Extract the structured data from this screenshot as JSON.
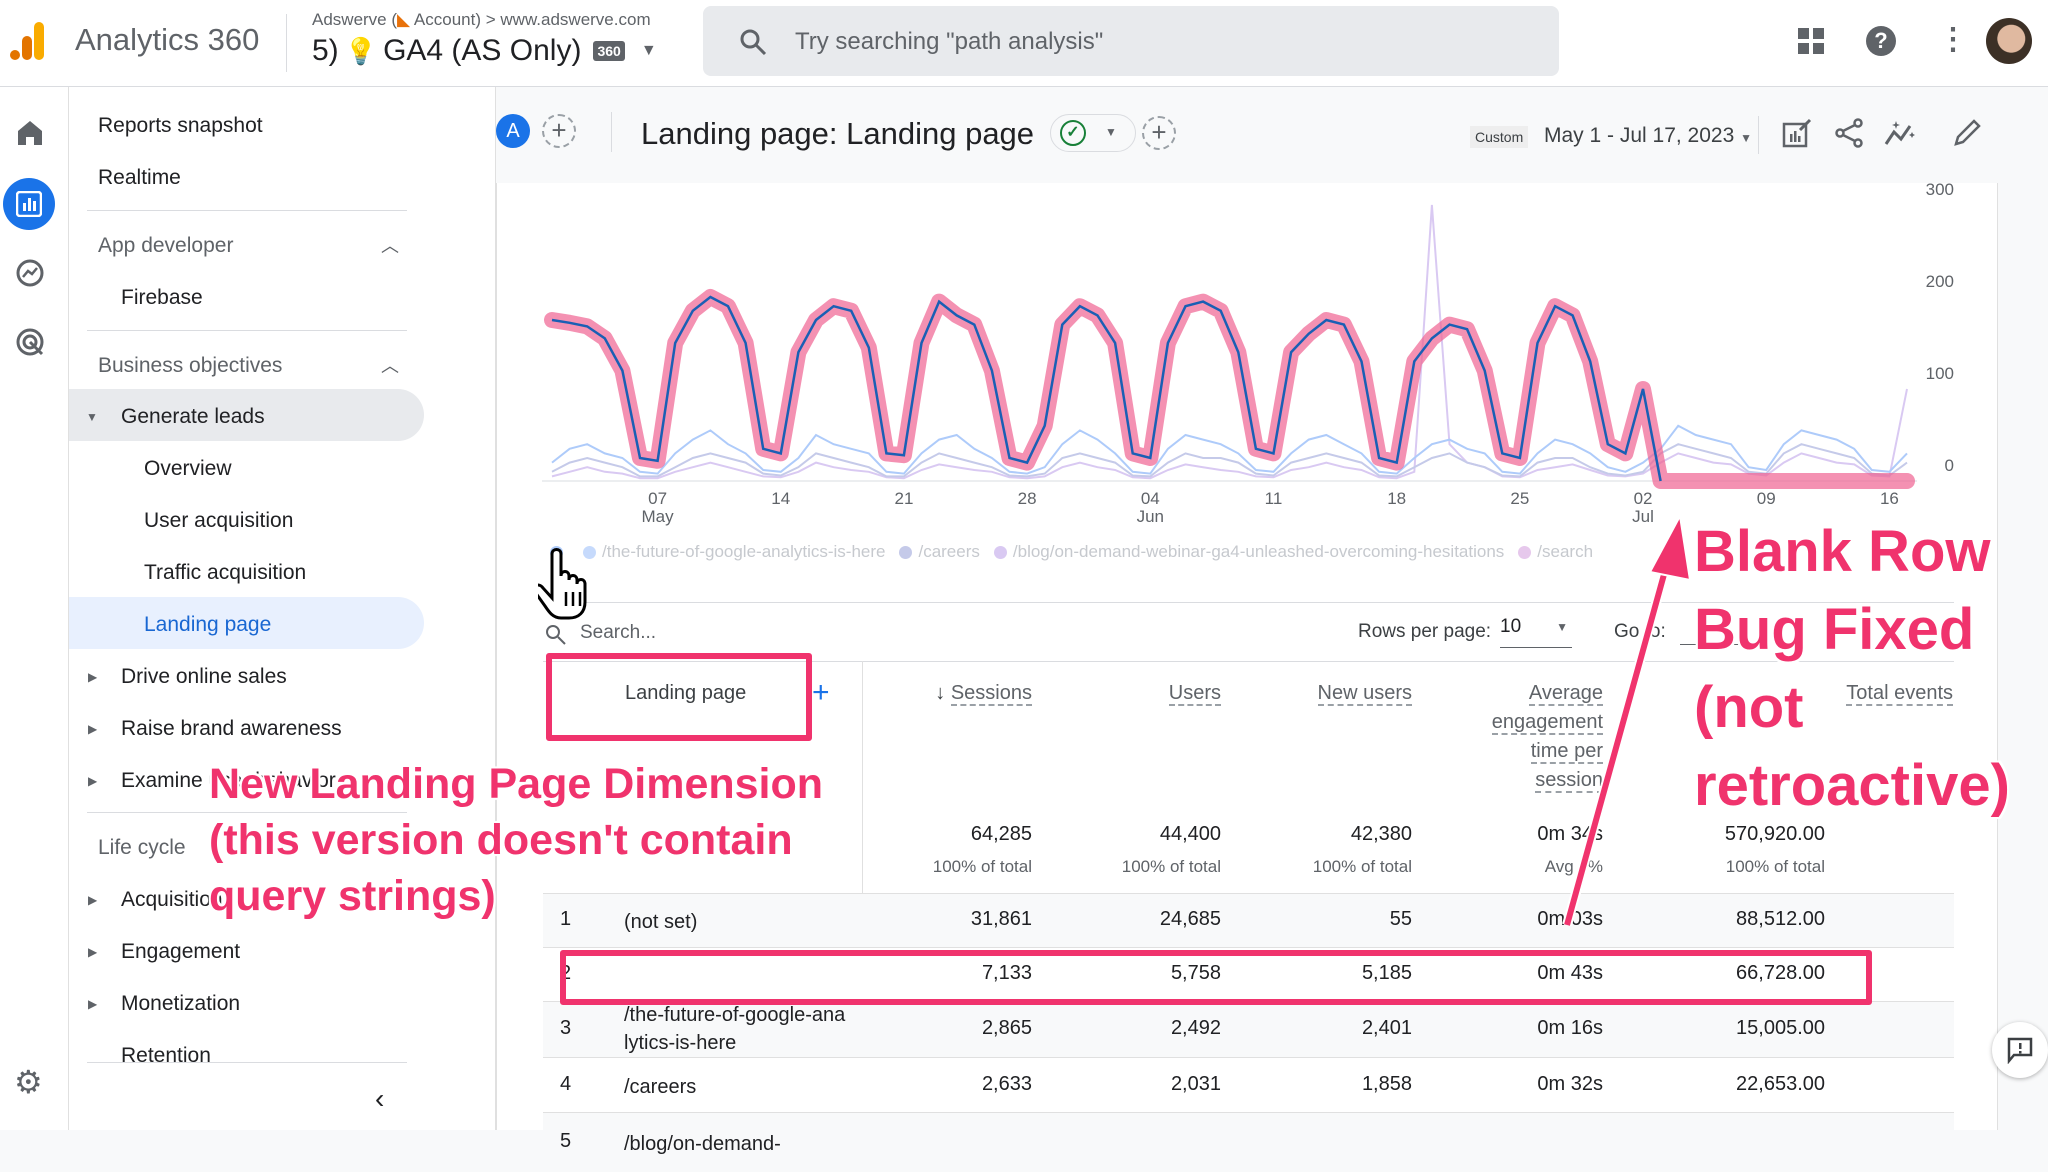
{
  "header": {
    "product": "Analytics 360",
    "breadcrumb_account": "Adswerve (",
    "breadcrumb_account_suffix": " Account)",
    "breadcrumb_sep": ">",
    "breadcrumb_property": "www.adswerve.com",
    "property_prefix": "5)",
    "property_name": "GA4 (AS Only)",
    "property_badge": "360",
    "search_placeholder": "Try searching \"path analysis\""
  },
  "sidebar": {
    "items": [
      {
        "label": "Reports snapshot"
      },
      {
        "label": "Realtime"
      },
      {
        "label": "App developer"
      },
      {
        "label": "Firebase"
      },
      {
        "label": "Business objectives"
      },
      {
        "label": "Generate leads"
      },
      {
        "label": "Overview"
      },
      {
        "label": "User acquisition"
      },
      {
        "label": "Traffic acquisition"
      },
      {
        "label": "Landing page"
      },
      {
        "label": "Drive online sales"
      },
      {
        "label": "Raise brand awareness"
      },
      {
        "label": "Examine user behavior"
      },
      {
        "label": "Life cycle"
      },
      {
        "label": "Acquisition"
      },
      {
        "label": "Engagement"
      },
      {
        "label": "Monetization"
      },
      {
        "label": "Retention"
      }
    ]
  },
  "toolbar": {
    "comparison_avatar": "A",
    "title": "Landing page: Landing page",
    "date_chip": "Custom",
    "date_range": "May 1 - Jul 17, 2023"
  },
  "legend": [
    {
      "label": "",
      "color": "#aecbfa"
    },
    {
      "label": "/the-future-of-google-analytics-is-here",
      "color": "#c6dafc"
    },
    {
      "label": "/careers",
      "color": "#c5cae9"
    },
    {
      "label": "/blog/on-demand-webinar-ga4-unleashed-overcoming-hesitations",
      "color": "#d9c9f2"
    },
    {
      "label": "/search",
      "color": "#e6c8ec"
    }
  ],
  "chart_data": {
    "type": "line",
    "x_start": "2023-05-01",
    "x_end": "2023-07-17",
    "x_ticks": [
      {
        "day": "07",
        "month": "May"
      },
      {
        "day": "14",
        "month": ""
      },
      {
        "day": "21",
        "month": ""
      },
      {
        "day": "28",
        "month": ""
      },
      {
        "day": "04",
        "month": "Jun"
      },
      {
        "day": "11",
        "month": ""
      },
      {
        "day": "18",
        "month": ""
      },
      {
        "day": "25",
        "month": ""
      },
      {
        "day": "02",
        "month": "Jul"
      },
      {
        "day": "09",
        "month": ""
      },
      {
        "day": "16",
        "month": ""
      }
    ],
    "y_ticks": [
      0,
      100,
      200,
      300
    ],
    "ylim": [
      0,
      300
    ],
    "grid": false,
    "legend_position": "bottom",
    "series": [
      {
        "color": "#1a5fb4",
        "highlight": "#f06292",
        "values": [
          175,
          172,
          168,
          155,
          120,
          25,
          22,
          150,
          185,
          200,
          190,
          150,
          35,
          30,
          140,
          175,
          190,
          185,
          145,
          30,
          28,
          150,
          195,
          180,
          170,
          120,
          25,
          20,
          60,
          170,
          190,
          180,
          150,
          30,
          25,
          150,
          190,
          195,
          185,
          140,
          35,
          30,
          140,
          160,
          175,
          170,
          130,
          25,
          20,
          130,
          155,
          170,
          165,
          120,
          30,
          25,
          150,
          190,
          180,
          130,
          40,
          30,
          100,
          0,
          0,
          0,
          0,
          0,
          0,
          0,
          0,
          0,
          0,
          0,
          0,
          0,
          0,
          0
        ]
      },
      {
        "color": "#aecbfa",
        "values": [
          20,
          35,
          40,
          30,
          25,
          10,
          8,
          30,
          45,
          55,
          40,
          30,
          12,
          10,
          25,
          50,
          40,
          35,
          30,
          10,
          8,
          30,
          45,
          50,
          35,
          25,
          10,
          8,
          15,
          40,
          55,
          45,
          30,
          10,
          8,
          35,
          50,
          45,
          40,
          30,
          12,
          10,
          30,
          45,
          50,
          40,
          30,
          10,
          8,
          25,
          40,
          45,
          35,
          30,
          10,
          8,
          30,
          45,
          40,
          30,
          15,
          10,
          20,
          35,
          60,
          50,
          45,
          40,
          15,
          12,
          40,
          55,
          50,
          45,
          35,
          12,
          10,
          30
        ]
      },
      {
        "color": "#c5cae9",
        "values": [
          10,
          20,
          25,
          20,
          15,
          5,
          5,
          15,
          25,
          30,
          25,
          20,
          8,
          6,
          15,
          30,
          25,
          20,
          15,
          5,
          5,
          20,
          30,
          25,
          20,
          15,
          6,
          5,
          8,
          25,
          30,
          25,
          20,
          6,
          5,
          20,
          30,
          25,
          25,
          20,
          8,
          6,
          20,
          25,
          30,
          25,
          20,
          6,
          5,
          15,
          25,
          30,
          20,
          15,
          6,
          5,
          20,
          25,
          25,
          15,
          8,
          6,
          10,
          30,
          40,
          35,
          30,
          25,
          10,
          8,
          30,
          40,
          35,
          30,
          25,
          8,
          6,
          20
        ]
      },
      {
        "color": "#d9c9f2",
        "values": [
          5,
          10,
          15,
          10,
          8,
          3,
          3,
          10,
          15,
          20,
          15,
          10,
          5,
          4,
          10,
          20,
          15,
          12,
          10,
          4,
          3,
          12,
          18,
          15,
          12,
          10,
          4,
          3,
          5,
          15,
          20,
          15,
          12,
          4,
          3,
          12,
          18,
          15,
          12,
          10,
          5,
          4,
          12,
          15,
          20,
          15,
          12,
          4,
          3,
          10,
          300,
          40,
          20,
          15,
          5,
          4,
          12,
          15,
          18,
          12,
          6,
          5,
          8,
          20,
          30,
          25,
          20,
          18,
          8,
          6,
          20,
          30,
          25,
          20,
          18,
          6,
          5,
          100
        ]
      }
    ]
  },
  "table": {
    "search_placeholder": "Search...",
    "rows_per_page_label": "Rows per page:",
    "rows_per_page_value": "10",
    "goto_label": "Go to:",
    "dimension_header": "Landing page",
    "add_dimension": "+",
    "columns": [
      {
        "label": "Sessions",
        "sorted": "desc"
      },
      {
        "label": "Users"
      },
      {
        "label": "New users"
      },
      {
        "label": "Average engagement time per session"
      },
      {
        "label": "Total events"
      }
    ],
    "totals": [
      {
        "value": "64,285",
        "sub": "100% of total"
      },
      {
        "value": "44,400",
        "sub": "100% of total"
      },
      {
        "value": "42,380",
        "sub": "100% of total"
      },
      {
        "value": "0m 34s",
        "sub": "Avg 0%"
      },
      {
        "value": "570,920.00",
        "sub": "100% of total"
      }
    ],
    "rows": [
      {
        "index": "1",
        "page": "(not set)",
        "cells": [
          "31,861",
          "24,685",
          "55",
          "0m 03s",
          "88,512.00"
        ]
      },
      {
        "index": "2",
        "page": "",
        "cells": [
          "7,133",
          "5,758",
          "5,185",
          "0m 43s",
          "66,728.00"
        ]
      },
      {
        "index": "3",
        "page": "/the-future-of-google-analytics-is-here",
        "cells": [
          "2,865",
          "2,492",
          "2,401",
          "0m 16s",
          "15,005.00"
        ]
      },
      {
        "index": "4",
        "page": "/careers",
        "cells": [
          "2,633",
          "2,031",
          "1,858",
          "0m 32s",
          "22,653.00"
        ]
      },
      {
        "index": "5",
        "page": "/blog/on-demand-",
        "cells": [
          "",
          "",
          "",
          "",
          ""
        ]
      }
    ]
  },
  "annotations": {
    "right_lines": [
      "Blank Row",
      "Bug Fixed",
      "(not",
      "retroactive)"
    ],
    "left_lines": [
      "New Landing Page Dimension",
      "(this version doesn't contain",
      "query strings)"
    ],
    "color": "#f0336d"
  }
}
